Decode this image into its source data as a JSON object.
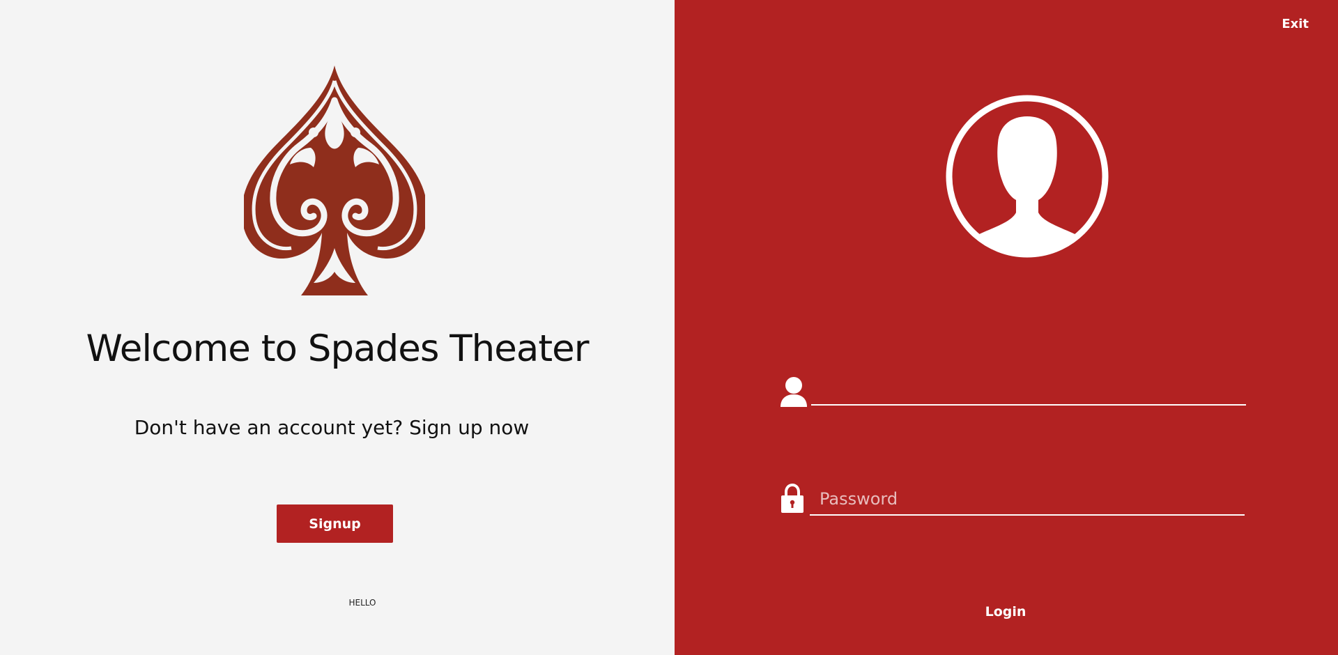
{
  "colors": {
    "brand_red": "#b22222",
    "left_background": "#f4f4f4",
    "logo_fill": "#8f2e1c",
    "logo_ornament": "#f4f4f4"
  },
  "welcome": {
    "title": "Welcome to Spades Theater",
    "signup_prompt": "Don't have an account yet? Sign up now",
    "signup_label": "Signup",
    "footer_text": "HELLO",
    "logo_icon": "spade-logo-icon"
  },
  "login": {
    "exit_label": "Exit",
    "avatar_icon": "user-avatar-icon",
    "username": {
      "icon": "user-icon",
      "value": "",
      "placeholder": ""
    },
    "password": {
      "icon": "lock-icon",
      "value": "",
      "placeholder": "Password"
    },
    "login_label": "Login"
  }
}
